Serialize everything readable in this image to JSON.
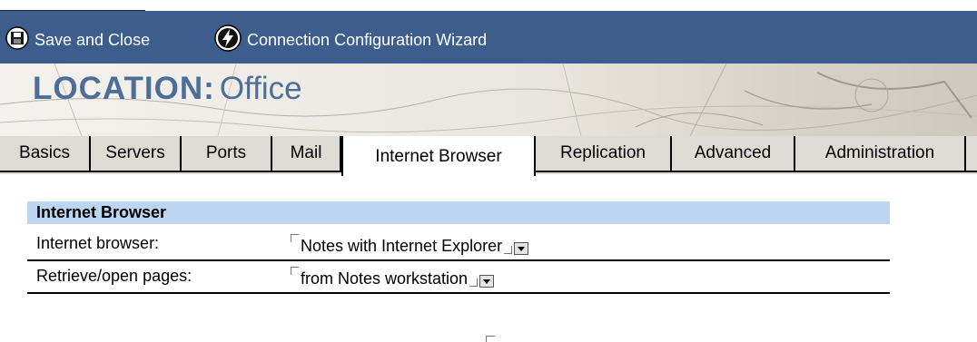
{
  "toolbar": {
    "save_label": "Save and Close",
    "save_icon": "floppy-disk-icon",
    "wizard_label": "Connection Configuration Wizard",
    "wizard_icon": "lightning-bolt-icon",
    "bg_color": "#3d5e8c"
  },
  "header": {
    "title_key": "LOCATION",
    "title_sep": ":",
    "title_value": "Office",
    "title_color": "#4e6e97"
  },
  "tabs": [
    {
      "label": "Basics"
    },
    {
      "label": "Servers"
    },
    {
      "label": "Ports"
    },
    {
      "label": "Mail"
    },
    {
      "label": "Internet Browser",
      "active": true
    },
    {
      "label": "Replication"
    },
    {
      "label": "Advanced"
    },
    {
      "label": "Administration"
    }
  ],
  "section": {
    "title": "Internet Browser",
    "bg_color": "#bcd6f2"
  },
  "fields": [
    {
      "label": "Internet browser:",
      "value": "Notes with Internet Explorer"
    },
    {
      "label": "Retrieve/open pages:",
      "value": "from Notes workstation"
    }
  ]
}
